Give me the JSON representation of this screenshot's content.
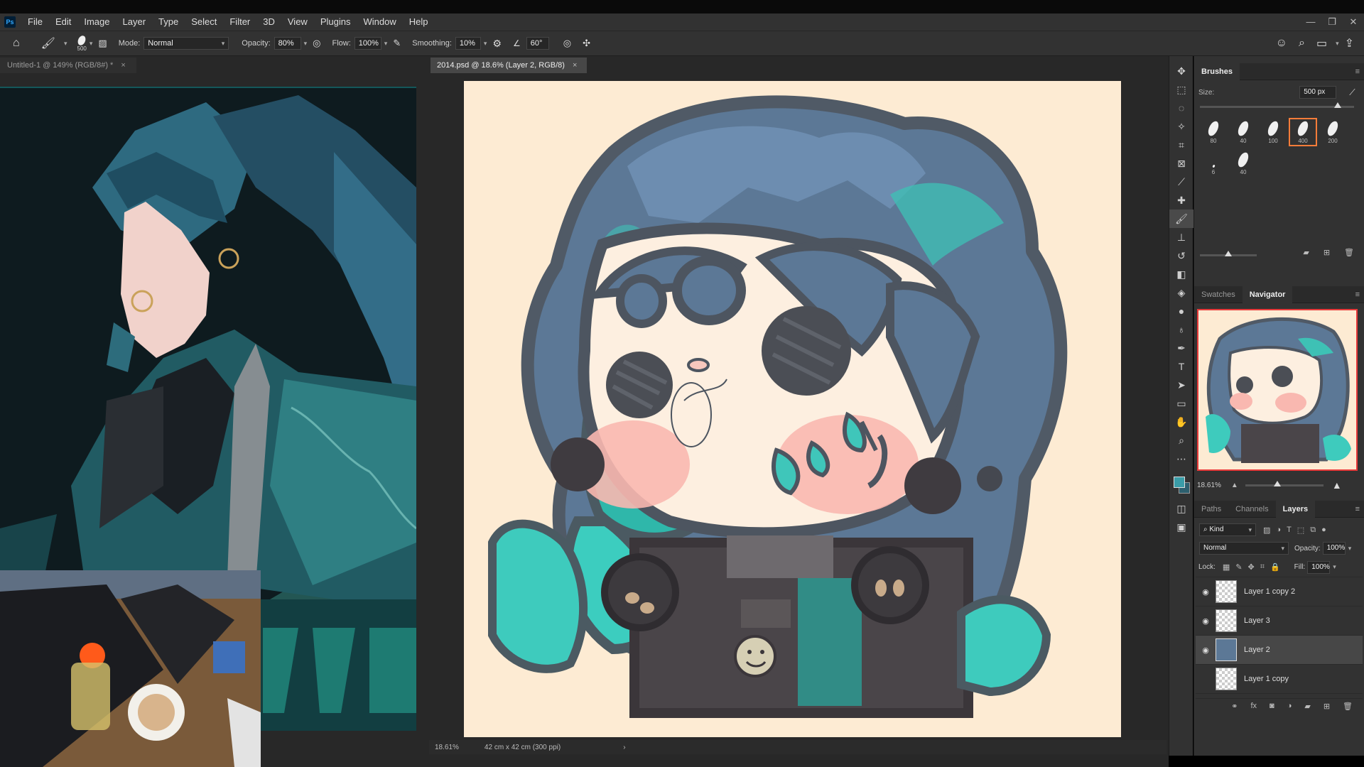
{
  "app": {
    "logo": "Ps"
  },
  "menu": [
    "File",
    "Edit",
    "Image",
    "Layer",
    "Type",
    "Select",
    "Filter",
    "3D",
    "View",
    "Plugins",
    "Window",
    "Help"
  ],
  "window_controls": {
    "minimize": "—",
    "restore": "❐",
    "close": "✕"
  },
  "options": {
    "brush_size": "500",
    "mode_label": "Mode:",
    "mode_value": "Normal",
    "opacity_label": "Opacity:",
    "opacity_value": "80%",
    "flow_label": "Flow:",
    "flow_value": "100%",
    "smoothing_label": "Smoothing:",
    "smoothing_value": "10%",
    "angle_value": "60°"
  },
  "documents": {
    "left_tab": "Untitled-1 @ 149% (RGB/8#) *",
    "center_tab": "2014.psd @ 18.6% (Layer 2, RGB/8)",
    "close_glyph": "×"
  },
  "status": {
    "zoom": "18.61%",
    "doc_info": "42 cm x 42 cm (300 ppi)",
    "arrow": "›"
  },
  "brushes_panel": {
    "title": "Brushes",
    "size_label": "Size:",
    "size_value": "500 px",
    "presets": [
      {
        "num": "80",
        "selected": false
      },
      {
        "num": "40",
        "selected": false
      },
      {
        "num": "100",
        "selected": false
      },
      {
        "num": "400",
        "selected": true
      },
      {
        "num": "200",
        "selected": false
      },
      {
        "num": "6",
        "selected": false
      },
      {
        "num": "40",
        "selected": false
      }
    ]
  },
  "nav_panel": {
    "tabs": [
      "Swatches",
      "Navigator"
    ],
    "active": "Navigator",
    "zoom": "18.61%"
  },
  "layers_panel": {
    "tabs": [
      "Paths",
      "Channels",
      "Layers"
    ],
    "active": "Layers",
    "filter_label": "Kind",
    "blend_mode": "Normal",
    "opacity_label": "Opacity:",
    "opacity_value": "100%",
    "lock_label": "Lock:",
    "fill_label": "Fill:",
    "fill_value": "100%",
    "layers": [
      {
        "name": "Layer 1 copy 2",
        "visible": true,
        "selected": false
      },
      {
        "name": "Layer 3",
        "visible": true,
        "selected": false
      },
      {
        "name": "Layer 2",
        "visible": true,
        "selected": true
      },
      {
        "name": "Layer 1 copy",
        "visible": false,
        "selected": false
      }
    ]
  },
  "colors": {
    "foreground": "#3a9da8",
    "background": "#2d5f6e",
    "accent_selected": "#ff7d3a"
  }
}
